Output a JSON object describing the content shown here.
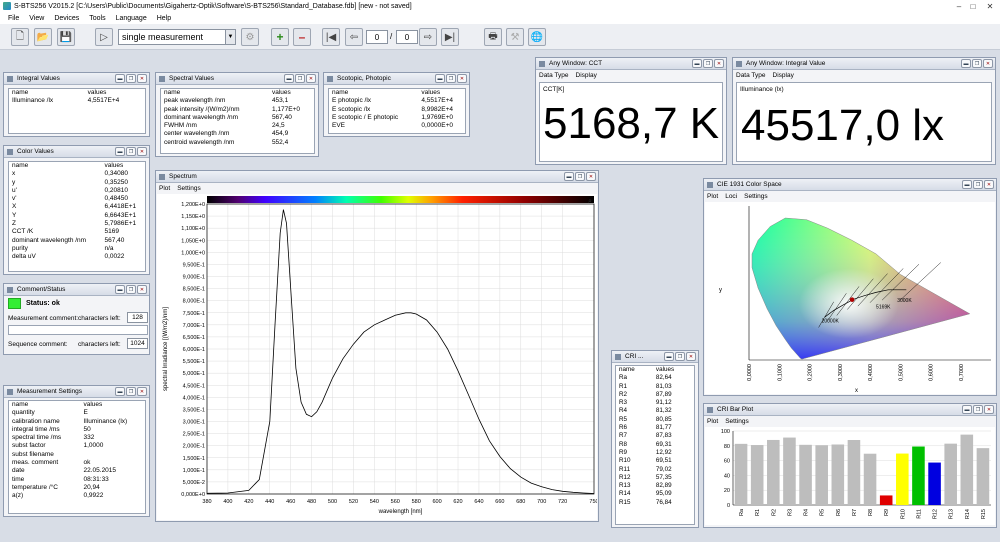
{
  "window": {
    "title": "S-BTS256 V2015.2 [C:\\Users\\Public\\Documents\\Gigahertz-Optik\\Software\\S-BTS256\\Standard_Database.fdb] [new - not saved]"
  },
  "menu": [
    "File",
    "View",
    "Devices",
    "Tools",
    "Language",
    "Help"
  ],
  "toolbar": {
    "mode": "single measurement",
    "page_current": "0",
    "page_sep": "/",
    "page_total": "0"
  },
  "integral": {
    "title": "Integral Values",
    "headers": [
      "name",
      "values"
    ],
    "rows": [
      [
        "Illuminance /lx",
        "4,5517E+4"
      ]
    ]
  },
  "spectral": {
    "title": "Spectral Values",
    "headers": [
      "name",
      "values"
    ],
    "rows": [
      [
        "peak wavelength /nm",
        "453,1"
      ],
      [
        "peak intensity /(W/m2)/nm",
        "1,177E+0"
      ],
      [
        "dominant wavelength /nm",
        "567,40"
      ],
      [
        "FWHM /nm",
        "24,5"
      ],
      [
        "center wavelength /nm",
        "454,9"
      ],
      [
        "centroid wavelength /nm",
        "552,4"
      ]
    ]
  },
  "scotopic": {
    "title": "Scotopic, Photopic",
    "headers": [
      "name",
      "values"
    ],
    "rows": [
      [
        "E photopic /lx",
        "4,5517E+4"
      ],
      [
        "E scotopic /lx",
        "8,9982E+4"
      ],
      [
        "E scotopic / E photopic",
        "1,9769E+0"
      ],
      [
        "EVE",
        "0,0000E+0"
      ]
    ]
  },
  "color": {
    "title": "Color Values",
    "headers": [
      "name",
      "values"
    ],
    "rows": [
      [
        "x",
        "0,34080"
      ],
      [
        "y",
        "0,35250"
      ],
      [
        "u'",
        "0,20810"
      ],
      [
        "v'",
        "0,48450"
      ],
      [
        "X",
        "6,4418E+1"
      ],
      [
        "Y",
        "6,6643E+1"
      ],
      [
        "Z",
        "5,7986E+1"
      ],
      [
        "CCT /K",
        "5169"
      ],
      [
        "dominant wavelength /nm",
        "567,40"
      ],
      [
        "purity",
        "n/a"
      ],
      [
        "delta uV",
        "0,0022"
      ]
    ]
  },
  "comment": {
    "title": "Comment/Status",
    "status": "Status: ok",
    "meas_label": "Measurement comment:",
    "chars_left": "characters left:",
    "meas_chars": "128",
    "seq_label": "Sequence comment:",
    "seq_chars": "1024"
  },
  "settings": {
    "title": "Measurement Settings",
    "headers": [
      "name",
      "values"
    ],
    "rows": [
      [
        "quantity",
        "E"
      ],
      [
        "calibration name",
        "Illuminance (lx)"
      ],
      [
        "integral time /ms",
        "50"
      ],
      [
        "spectral time /ms",
        "332"
      ],
      [
        "subst factor",
        "1,0000"
      ],
      [
        "subst filename",
        ""
      ],
      [
        "meas. comment",
        "ok"
      ],
      [
        "date",
        "22.05.2015"
      ],
      [
        "time",
        "08:31:33"
      ],
      [
        "temperature /°C",
        "20,94"
      ],
      [
        "a(z)",
        "0,9922"
      ]
    ]
  },
  "cct": {
    "title": "Any Window: CCT",
    "menu": [
      "Data Type",
      "Display"
    ],
    "label": "CCT[K]",
    "value": "5168,7 K"
  },
  "illum": {
    "title": "Any Window: Integral Value",
    "menu": [
      "Data Type",
      "Display"
    ],
    "label": "Illuminance (lx)",
    "value": "45517,0 lx"
  },
  "spectrum": {
    "title": "Spectrum",
    "menu": [
      "Plot",
      "Settings"
    ]
  },
  "cie": {
    "title": "CIE 1931 Color Space",
    "menu": [
      "Plot",
      "Loci",
      "Settings"
    ],
    "xlabel": "x",
    "ylabel": "y",
    "xticks": [
      "0,0000",
      "0,1000",
      "0,2000",
      "0,3000",
      "0,4000",
      "0,5000",
      "0,6000",
      "0,7000"
    ],
    "loci_labels": [
      "20000K",
      "5169K",
      "3000K"
    ]
  },
  "cri_table": {
    "title": "CRI ...",
    "headers": [
      "name",
      "values"
    ],
    "rows": [
      [
        "Ra",
        "82,64"
      ],
      [
        "R1",
        "81,03"
      ],
      [
        "R2",
        "87,89"
      ],
      [
        "R3",
        "91,12"
      ],
      [
        "R4",
        "81,32"
      ],
      [
        "R5",
        "80,85"
      ],
      [
        "R6",
        "81,77"
      ],
      [
        "R7",
        "87,83"
      ],
      [
        "R8",
        "69,31"
      ],
      [
        "R9",
        "12,92"
      ],
      [
        "R10",
        "69,51"
      ],
      [
        "R11",
        "79,02"
      ],
      [
        "R12",
        "57,35"
      ],
      [
        "R13",
        "82,89"
      ],
      [
        "R14",
        "95,09"
      ],
      [
        "R15",
        "76,84"
      ]
    ]
  },
  "cri_bar": {
    "title": "CRI Bar Plot",
    "menu": [
      "Plot",
      "Settings"
    ]
  },
  "colors": {
    "status_ok": "#33ee33",
    "panel_border": "#8f9bb0",
    "bar_gray": "#bdbdbd",
    "bar_r9": "#e00000",
    "bar_r10": "#ffff00",
    "bar_r11": "#00c000",
    "bar_r12": "#0000e0"
  },
  "chart_data": [
    {
      "type": "line",
      "title": "",
      "xlabel": "wavelength [nm]",
      "ylabel": "spectral Irradiance [(W/m2)/nm]",
      "xlim": [
        380,
        750
      ],
      "ylim": [
        0,
        1.2
      ],
      "xticks": [
        "380",
        "400",
        "420",
        "440",
        "460",
        "480",
        "500",
        "520",
        "540",
        "560",
        "580",
        "600",
        "620",
        "640",
        "660",
        "680",
        "700",
        "720",
        "750"
      ],
      "yticks": [
        "0,000E+0",
        "5,000E-2",
        "1,000E-1",
        "1,500E-1",
        "2,000E-1",
        "2,500E-1",
        "3,000E-1",
        "3,500E-1",
        "4,000E-1",
        "4,500E-1",
        "5,000E-1",
        "5,500E-1",
        "6,000E-1",
        "6,500E-1",
        "7,000E-1",
        "7,500E-1",
        "8,000E-1",
        "8,500E-1",
        "9,000E-1",
        "9,500E-1",
        "1,000E+0",
        "1,050E+0",
        "1,100E+0",
        "1,150E+0",
        "1,200E+0"
      ],
      "x": [
        380,
        400,
        420,
        430,
        440,
        445,
        450,
        453,
        456,
        460,
        465,
        470,
        475,
        480,
        485,
        490,
        500,
        510,
        520,
        530,
        540,
        550,
        560,
        570,
        575,
        580,
        590,
        600,
        610,
        620,
        630,
        640,
        650,
        660,
        670,
        680,
        690,
        700,
        710,
        720,
        730,
        740,
        750
      ],
      "y": [
        0.003,
        0.004,
        0.015,
        0.06,
        0.3,
        0.7,
        1.08,
        1.177,
        1.12,
        0.85,
        0.52,
        0.38,
        0.33,
        0.32,
        0.34,
        0.38,
        0.48,
        0.56,
        0.62,
        0.67,
        0.7,
        0.72,
        0.74,
        0.75,
        0.75,
        0.745,
        0.72,
        0.67,
        0.6,
        0.51,
        0.41,
        0.31,
        0.22,
        0.155,
        0.105,
        0.07,
        0.045,
        0.03,
        0.018,
        0.011,
        0.007,
        0.004,
        0.002
      ]
    },
    {
      "type": "bar",
      "title": "",
      "categories": [
        "Ra",
        "R1",
        "R2",
        "R3",
        "R4",
        "R5",
        "R6",
        "R7",
        "R8",
        "R9",
        "R10",
        "R11",
        "R12",
        "R13",
        "R14",
        "R15"
      ],
      "values": [
        82.64,
        81.03,
        87.89,
        91.12,
        81.32,
        80.85,
        81.77,
        87.83,
        69.31,
        12.92,
        69.51,
        79.02,
        57.35,
        82.89,
        95.09,
        76.84
      ],
      "ylim": [
        0,
        100
      ],
      "yticks": [
        "0",
        "20",
        "40",
        "60",
        "80",
        "100"
      ]
    }
  ]
}
